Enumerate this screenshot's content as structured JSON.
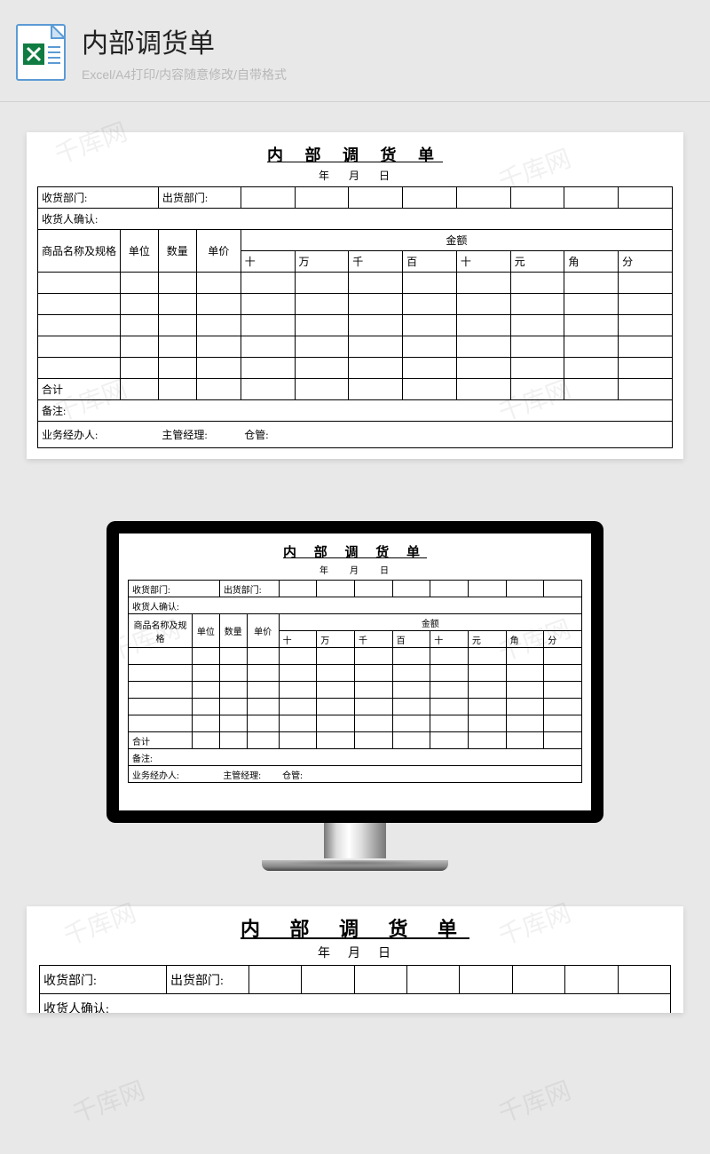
{
  "header": {
    "title": "内部调货单",
    "subtitle": "Excel/A4打印/内容随意修改/自带格式"
  },
  "form": {
    "title": "内 部 调 货 单",
    "date_y": "年",
    "date_m": "月",
    "date_d": "日",
    "recv_dept_label": "收货部门:",
    "ship_dept_label": "出货部门:",
    "recv_confirm_label": "收货人确认:",
    "col_name": "商品名称及规格",
    "col_unit": "单位",
    "col_qty": "数量",
    "col_price": "单价",
    "col_amount": "金额",
    "amt_sub": [
      "十",
      "万",
      "千",
      "百",
      "十",
      "元",
      "角",
      "分"
    ],
    "total_label": "合计",
    "remark_label": "备注:",
    "handler_label": "业务经办人:",
    "manager_label": "主管经理:",
    "warehouse_label": "仓管:"
  },
  "watermark": "千库网"
}
